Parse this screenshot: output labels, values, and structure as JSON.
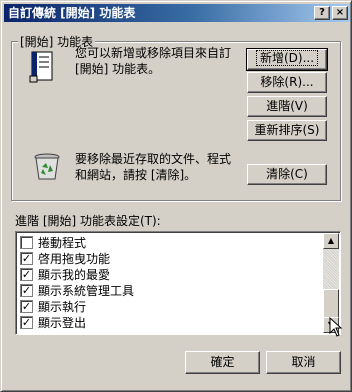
{
  "titlebar": {
    "title": "自訂傳統 [開始] 功能表",
    "help_label": "?",
    "close_label": "×"
  },
  "start_menu_group": {
    "label": "[開始] 功能表",
    "description_line1": "您可以新增或移除項目來自訂",
    "description_line2": "[開始] 功能表。",
    "clear_line1": "要移除最近存取的文件、程式",
    "clear_line2": "和網站，請按 [清除]。",
    "buttons": {
      "add": "新增(D)...",
      "remove": "移除(R)...",
      "advanced": "進階(V)",
      "resort": "重新排序(S)",
      "clear": "清除(C)"
    }
  },
  "advanced_settings": {
    "label": "進階 [開始] 功能表設定(T):",
    "items": [
      {
        "label": "捲動程式",
        "checked": false
      },
      {
        "label": "啓用拖曳功能",
        "checked": true
      },
      {
        "label": "顯示我的最愛",
        "checked": true
      },
      {
        "label": "顯示系統管理工具",
        "checked": true
      },
      {
        "label": "顯示執行",
        "checked": true
      },
      {
        "label": "顯示登出",
        "checked": true
      }
    ]
  },
  "footer": {
    "ok": "確定",
    "cancel": "取消"
  },
  "colors": {
    "titlebar_start": "#0a246a",
    "titlebar_end": "#a6caf0",
    "face": "#d4d0c8"
  }
}
